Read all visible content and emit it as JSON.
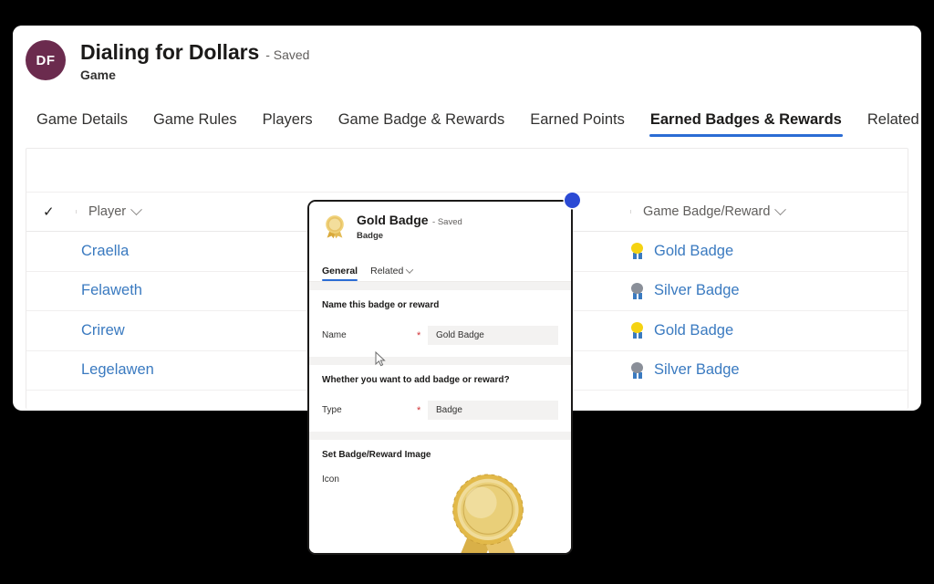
{
  "record": {
    "avatar_initials": "DF",
    "title": "Dialing for Dollars",
    "saved_label": "- Saved",
    "subtitle": "Game",
    "avatar_color": "#6b2b4e"
  },
  "tabs": [
    {
      "label": "Game Details",
      "active": false
    },
    {
      "label": "Game Rules",
      "active": false
    },
    {
      "label": "Players",
      "active": false
    },
    {
      "label": "Game Badge & Rewards",
      "active": false
    },
    {
      "label": "Earned Points",
      "active": false
    },
    {
      "label": "Earned Badges & Rewards",
      "active": true
    },
    {
      "label": "Related",
      "active": false
    }
  ],
  "accent_color": "#2b6cd4",
  "link_color": "#3a7ac0",
  "grid": {
    "select_all_icon": "checkmark-icon",
    "columns": [
      {
        "key": "player",
        "label": "Player",
        "sort_icon": "chevron-down-icon"
      },
      {
        "key": "badge",
        "label": "Game Badge/Reward",
        "sort_icon": "chevron-down-icon"
      }
    ],
    "rows": [
      {
        "player": "Craella",
        "badge": "Gold Badge",
        "badge_type": "gold"
      },
      {
        "player": "Felaweth",
        "badge": "Silver Badge",
        "badge_type": "silver"
      },
      {
        "player": "Crirew",
        "badge": "Gold Badge",
        "badge_type": "gold"
      },
      {
        "player": "Legelawen",
        "badge": "Silver Badge",
        "badge_type": "silver"
      }
    ]
  },
  "popup": {
    "icon": "gold-medal-icon",
    "title": "Gold Badge",
    "saved_label": "- Saved",
    "subtitle": "Badge",
    "tabs": [
      {
        "label": "General",
        "active": true,
        "chevron": false
      },
      {
        "label": "Related",
        "active": false,
        "chevron": true
      }
    ],
    "sections": [
      {
        "title": "Name this badge or reward",
        "field_label": "Name",
        "required_mark": "*",
        "field_value": "Gold Badge"
      },
      {
        "title": "Whether you want to add badge or reward?",
        "field_label": "Type",
        "required_mark": "*",
        "field_value": "Badge"
      }
    ],
    "image_section": {
      "title": "Set Badge/Reward Image",
      "field_label": "Icon",
      "image": "gold-rosette-medal"
    },
    "drag_handle_color": "#2b4ad4"
  }
}
